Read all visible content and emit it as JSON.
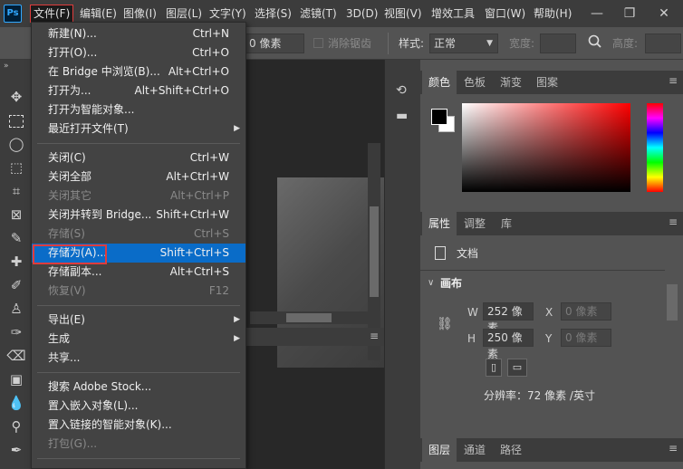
{
  "app_logo": "Ps",
  "menubar": {
    "items": [
      "文件(F)",
      "编辑(E)",
      "图像(I)",
      "图层(L)",
      "文字(Y)",
      "选择(S)",
      "滤镜(T)",
      "3D(D)",
      "视图(V)",
      "增效工具",
      "窗口(W)",
      "帮助(H)"
    ]
  },
  "window_controls": {
    "minimize": "—",
    "restore": "❐",
    "close": "✕"
  },
  "options_bar": {
    "size_value": "0 像素",
    "antialias_label": "消除锯齿",
    "style_label": "样式:",
    "style_value": "正常",
    "width_label": "宽度:",
    "height_label": "高度:"
  },
  "file_menu": {
    "items": [
      {
        "label": "新建(N)...",
        "shortcut": "Ctrl+N"
      },
      {
        "label": "打开(O)...",
        "shortcut": "Ctrl+O"
      },
      {
        "label": "在 Bridge 中浏览(B)...",
        "shortcut": "Alt+Ctrl+O"
      },
      {
        "label": "打开为...",
        "shortcut": "Alt+Shift+Ctrl+O"
      },
      {
        "label": "打开为智能对象...",
        "shortcut": ""
      },
      {
        "label": "最近打开文件(T)",
        "shortcut": ""
      },
      {
        "label": "关闭(C)",
        "shortcut": "Ctrl+W"
      },
      {
        "label": "关闭全部",
        "shortcut": "Alt+Ctrl+W"
      },
      {
        "label": "关闭其它",
        "shortcut": "Alt+Ctrl+P"
      },
      {
        "label": "关闭并转到 Bridge...",
        "shortcut": "Shift+Ctrl+W"
      },
      {
        "label": "存储(S)",
        "shortcut": "Ctrl+S"
      },
      {
        "label": "存储为(A)...",
        "shortcut": "Shift+Ctrl+S"
      },
      {
        "label": "存储副本...",
        "shortcut": "Alt+Ctrl+S"
      },
      {
        "label": "恢复(V)",
        "shortcut": "F12"
      },
      {
        "label": "导出(E)",
        "shortcut": ""
      },
      {
        "label": "生成",
        "shortcut": ""
      },
      {
        "label": "共享...",
        "shortcut": ""
      },
      {
        "label": "搜索 Adobe Stock...",
        "shortcut": ""
      },
      {
        "label": "置入嵌入对象(L)...",
        "shortcut": ""
      },
      {
        "label": "置入链接的智能对象(K)...",
        "shortcut": ""
      },
      {
        "label": "打包(G)...",
        "shortcut": ""
      }
    ]
  },
  "color_panel": {
    "tabs": [
      "颜色",
      "色板",
      "渐变",
      "图案"
    ]
  },
  "properties_panel": {
    "tabs": [
      "属性",
      "调整",
      "库"
    ],
    "doc_label": "文档",
    "section": "画布",
    "w_label": "W",
    "w_value": "252 像素",
    "h_label": "H",
    "h_value": "250 像素",
    "x_label": "X",
    "x_placeholder": "0 像素",
    "y_label": "Y",
    "y_placeholder": "0 像素",
    "resolution": "分辨率：72 像素 /英寸"
  },
  "layers_panel": {
    "tabs": [
      "图层",
      "通道",
      "路径"
    ]
  },
  "colors": {
    "highlight": "#0a6cc8",
    "annotation_red": "#e03c3c"
  }
}
